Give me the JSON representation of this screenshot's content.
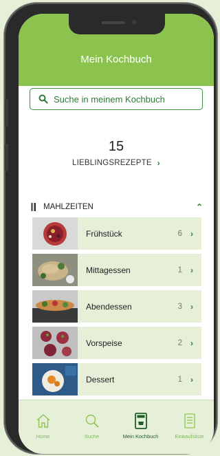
{
  "header": {
    "title": "Mein Kochbuch"
  },
  "search": {
    "placeholder": "Suche in meinem Kochbuch",
    "icon": "search-icon"
  },
  "favorites": {
    "count": "15",
    "label": "LIEBLINGSREZEPTE",
    "chevron": "›"
  },
  "section": {
    "label": "MAHLZEITEN",
    "icon": "cutlery-icon",
    "toggle": "⌃"
  },
  "meals": [
    {
      "name": "Frühstück",
      "count": "6",
      "arrow": "›"
    },
    {
      "name": "Mittagessen",
      "count": "1",
      "arrow": "›"
    },
    {
      "name": "Abendessen",
      "count": "3",
      "arrow": "›"
    },
    {
      "name": "Vorspeise",
      "count": "2",
      "arrow": "›"
    },
    {
      "name": "Dessert",
      "count": "1",
      "arrow": "›"
    }
  ],
  "tabs": [
    {
      "label": "Home",
      "icon": "home-icon",
      "active": false
    },
    {
      "label": "Suche",
      "icon": "search-icon",
      "active": false
    },
    {
      "label": "Mein Kochbuch",
      "icon": "cookbook-icon",
      "active": true
    },
    {
      "label": "Einkaufsliste",
      "icon": "shopping-list-icon",
      "active": false
    }
  ],
  "colors": {
    "header_green": "#8cc34f",
    "accent_dark_green": "#2e7a35",
    "row_background": "#e6efd8",
    "tab_inactive": "#7fb85a"
  }
}
